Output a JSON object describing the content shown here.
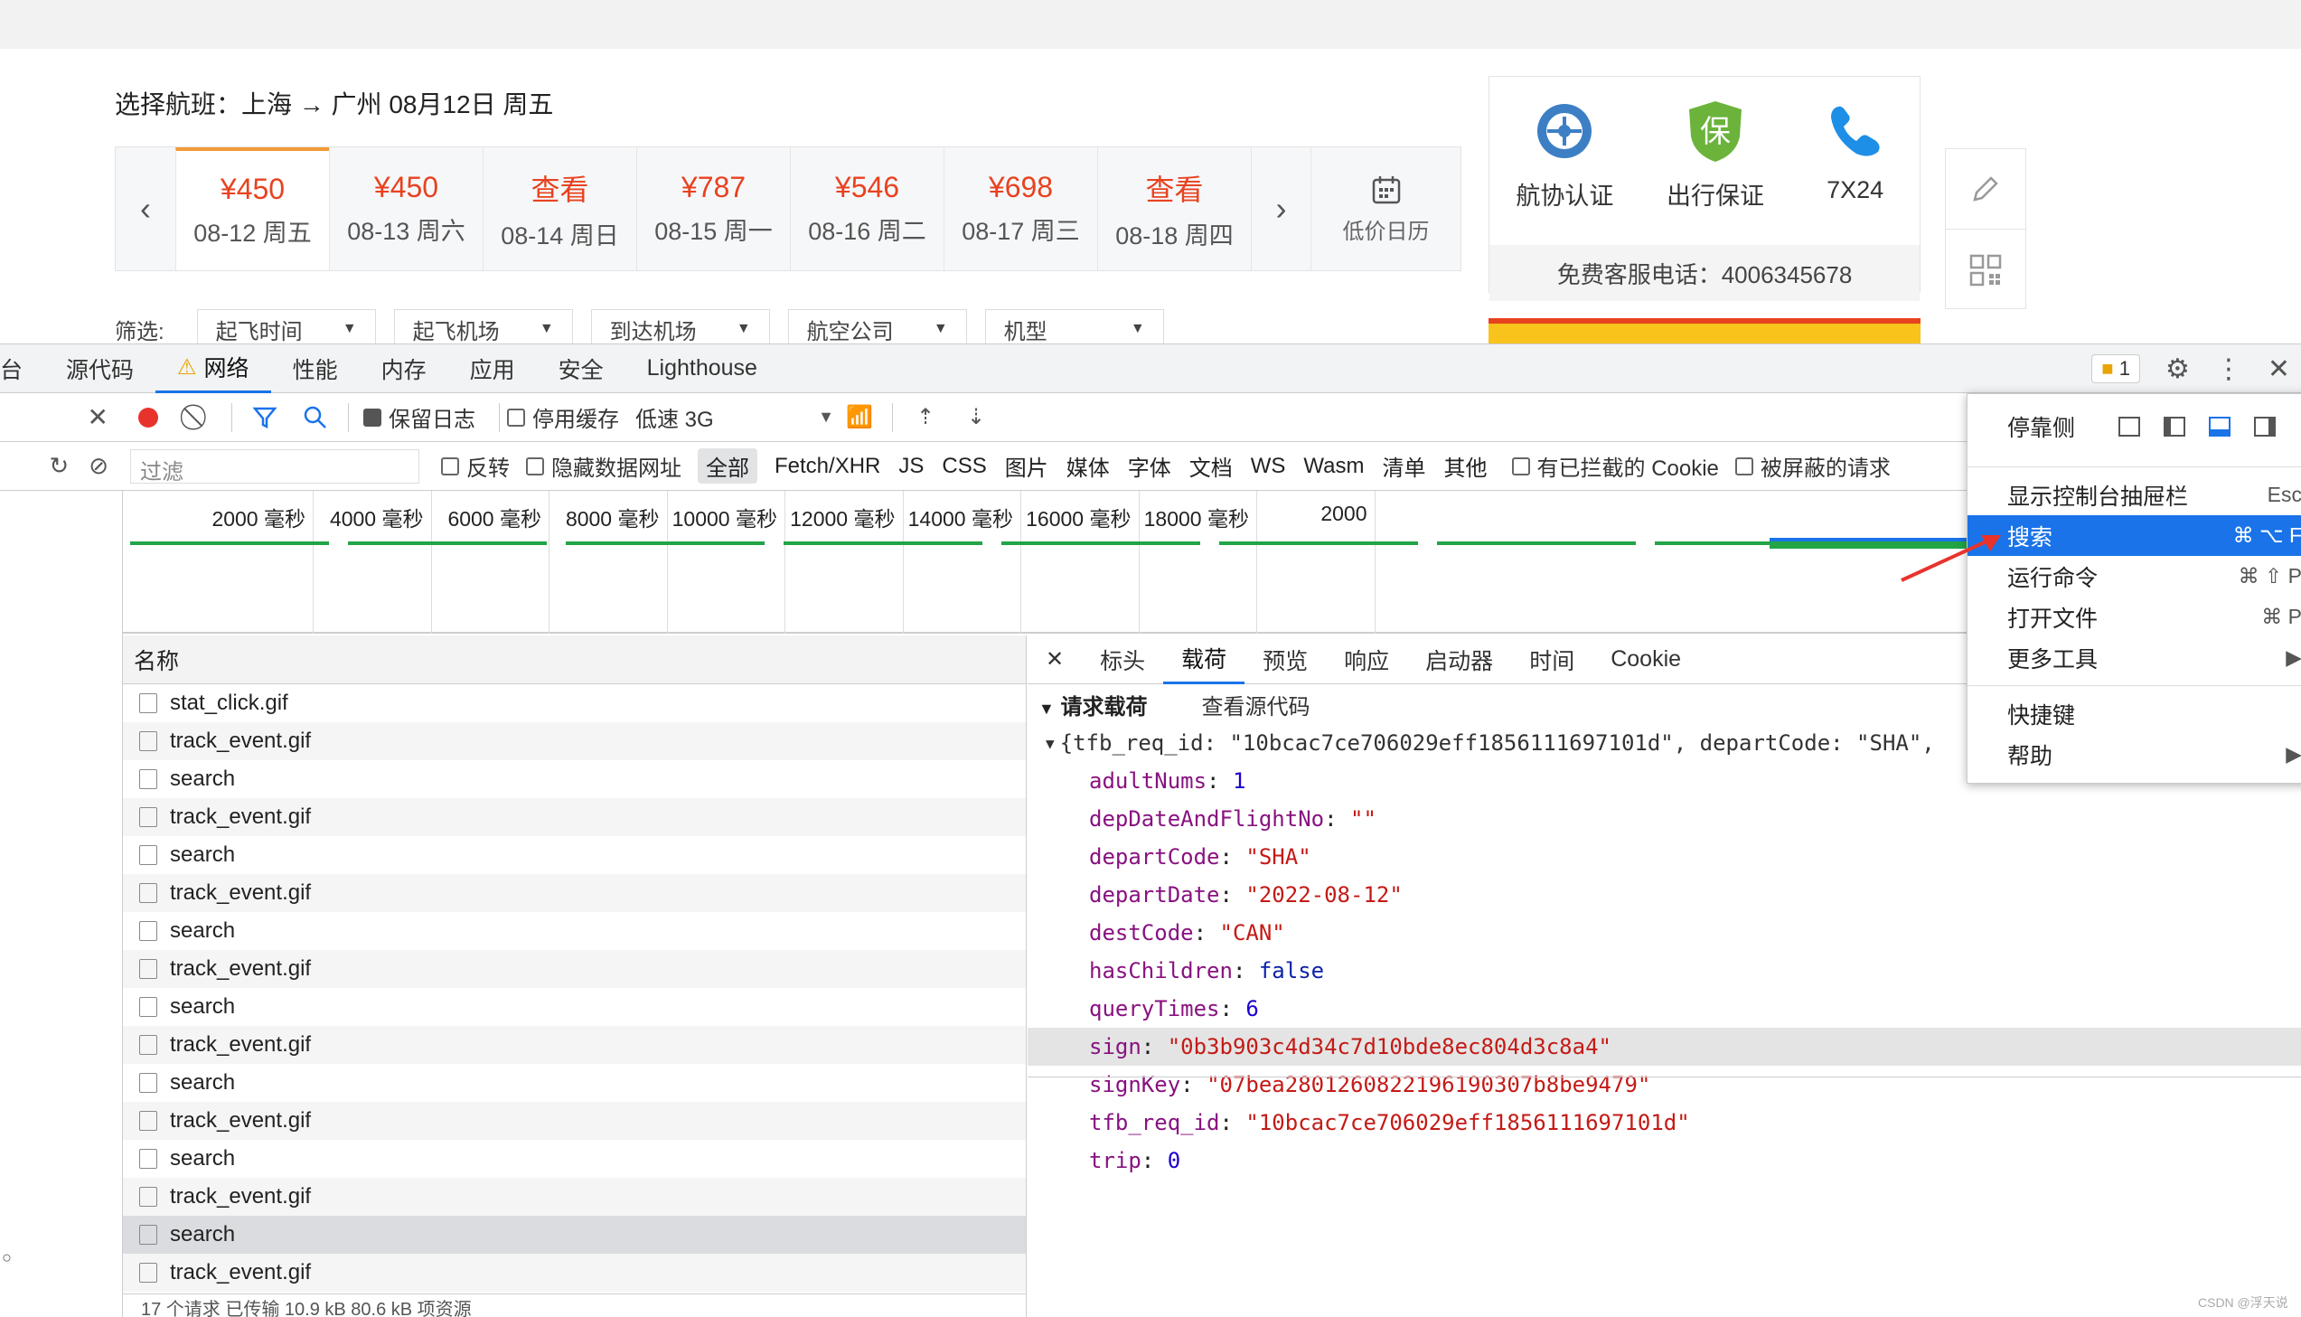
{
  "page": {
    "route_label": "选择航班：上海 → 广州 08月12日 周五",
    "dates": [
      {
        "price": "¥450",
        "date": "08-12 周五",
        "active": true
      },
      {
        "price": "¥450",
        "date": "08-13 周六"
      },
      {
        "price": "查看",
        "date": "08-14 周日"
      },
      {
        "price": "¥787",
        "date": "08-15 周一"
      },
      {
        "price": "¥546",
        "date": "08-16 周二"
      },
      {
        "price": "¥698",
        "date": "08-17 周三"
      },
      {
        "price": "查看",
        "date": "08-18 周四"
      }
    ],
    "calendar_label": "低价日历",
    "services": [
      "航协认证",
      "出行保证",
      "7X24"
    ],
    "hotline": "免费客服电话：4006345678",
    "filter_label": "筛选:",
    "filters": [
      "起飞时间",
      "起飞机场",
      "到达机场",
      "航空公司",
      "机型"
    ],
    "colors": {
      "price": "#e8421f",
      "active_tab": "#f29b37",
      "accent": "#1a73e8"
    }
  },
  "devtools": {
    "tabs": [
      "台",
      "源代码",
      "网络",
      "性能",
      "内存",
      "应用",
      "安全",
      "Lighthouse"
    ],
    "issues_count": "1",
    "toolbar": {
      "preserve_log": "保留日志",
      "disable_cache": "停用缓存",
      "throttle": "低速 3G"
    },
    "filter": {
      "placeholder": "过滤",
      "invert": "反转",
      "hide_data_urls": "隐藏数据网址",
      "types": [
        "全部",
        "Fetch/XHR",
        "JS",
        "CSS",
        "图片",
        "媒体",
        "字体",
        "文档",
        "WS",
        "Wasm",
        "清单",
        "其他"
      ],
      "blocked_cookies": "有已拦截的 Cookie",
      "blocked_requests": "被屏蔽的请求"
    },
    "timeline_ticks": [
      "2000 毫秒",
      "4000 毫秒",
      "6000 毫秒",
      "8000 毫秒",
      "10000 毫秒",
      "12000 毫秒",
      "14000 毫秒",
      "16000 毫秒",
      "18000 毫秒",
      "2000"
    ],
    "list_header": "名称",
    "requests": [
      "stat_click.gif",
      "track_event.gif",
      "search",
      "track_event.gif",
      "search",
      "track_event.gif",
      "search",
      "track_event.gif",
      "search",
      "track_event.gif",
      "search",
      "track_event.gif",
      "search",
      "track_event.gif",
      "search",
      "track_event.gif"
    ],
    "status": "17 个请求  已传输 10.9 kB  80.6 kB 项资源",
    "detail_tabs": [
      "标头",
      "载荷",
      "预览",
      "响应",
      "启动器",
      "时间",
      "Cookie"
    ],
    "payload_title": "请求载荷",
    "view_source": "查看源代码",
    "payload_summary": "{tfb_req_id: \"10bcac7ce706029eff1856111697101d\", departCode: \"SHA\",",
    "payload": [
      {
        "key": "adultNums",
        "value": "1",
        "kind": "n"
      },
      {
        "key": "depDateAndFlightNo",
        "value": "\"\"",
        "kind": "s"
      },
      {
        "key": "departCode",
        "value": "\"SHA\"",
        "kind": "s"
      },
      {
        "key": "departDate",
        "value": "\"2022-08-12\"",
        "kind": "s"
      },
      {
        "key": "destCode",
        "value": "\"CAN\"",
        "kind": "s"
      },
      {
        "key": "hasChildren",
        "value": "false",
        "kind": "b"
      },
      {
        "key": "queryTimes",
        "value": "6",
        "kind": "n"
      },
      {
        "key": "sign",
        "value": "\"0b3b903c4d34c7d10bde8ec804d3c8a4\"",
        "kind": "s",
        "highlight": true
      },
      {
        "key": "signKey",
        "value": "\"07bea2801260822196190307b8be9479\"",
        "kind": "s"
      },
      {
        "key": "tfb_req_id",
        "value": "\"10bcac7ce706029eff1856111697101d\"",
        "kind": "s"
      },
      {
        "key": "trip",
        "value": "0",
        "kind": "n"
      }
    ],
    "menu": {
      "dock_label": "停靠侧",
      "items": [
        {
          "label": "显示控制台抽屉栏",
          "shortcut": "Esc"
        },
        {
          "label": "搜索",
          "shortcut": "⌘ ⌥ F",
          "active": true
        },
        {
          "label": "运行命令",
          "shortcut": "⌘ ⇧ P"
        },
        {
          "label": "打开文件",
          "shortcut": "⌘ P"
        },
        {
          "label": "更多工具",
          "shortcut": "▶"
        },
        {
          "label": "快捷键",
          "shortcut": ""
        },
        {
          "label": "帮助",
          "shortcut": "▶"
        }
      ]
    }
  },
  "watermark": "CSDN @浮天说"
}
